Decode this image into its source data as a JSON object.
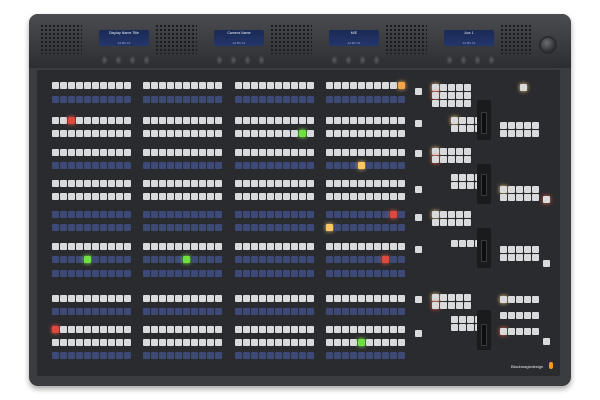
{
  "device": {
    "brand": "Blackmagicdesign",
    "displays": [
      {
        "title": "Display Name Title",
        "subtitle": "A1 B1 C1"
      },
      {
        "title": "Camera Name",
        "subtitle": "A1 B1 C1"
      },
      {
        "title": "M/E",
        "subtitle": "A1 B1 C1"
      },
      {
        "title": "Aux 1",
        "subtitle": "A1 B1 C1"
      }
    ]
  },
  "colors": {
    "red": "#e0483f",
    "green": "#6ee03f",
    "amber": "#ffc85e",
    "white_key": "#d9dadc",
    "blue_key": "#3d4a78"
  }
}
